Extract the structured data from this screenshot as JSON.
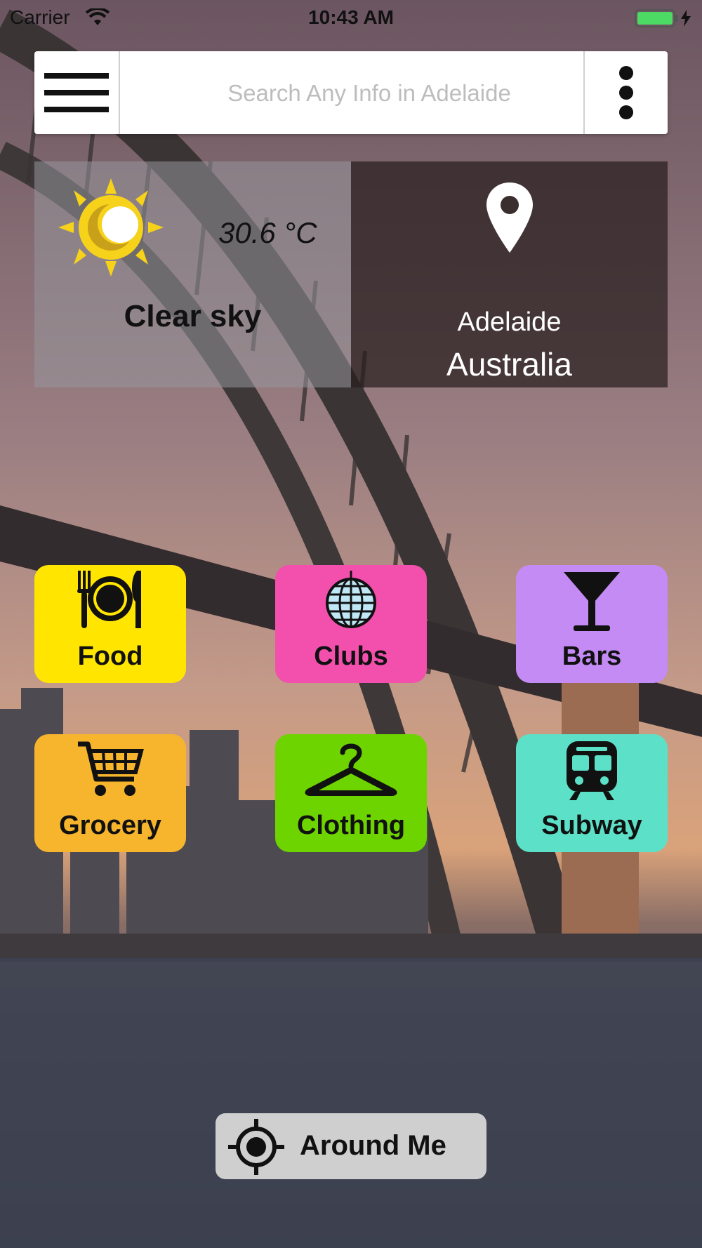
{
  "status_bar": {
    "carrier": "Carrier",
    "time": "10:43 AM"
  },
  "search": {
    "placeholder": "Search Any Info in Adelaide"
  },
  "weather": {
    "icon": "sun-moon-icon",
    "temperature": "30.6 °C",
    "description": "Clear sky"
  },
  "location": {
    "icon": "map-pin-icon",
    "city": "Adelaide",
    "country": "Australia"
  },
  "categories": [
    {
      "label": "Food",
      "icon": "food-plate-icon",
      "color": "#FFE500"
    },
    {
      "label": "Clubs",
      "icon": "disco-ball-icon",
      "color": "#F350AE"
    },
    {
      "label": "Bars",
      "icon": "cocktail-glass-icon",
      "color": "#C48BF5"
    },
    {
      "label": "Grocery",
      "icon": "shopping-cart-icon",
      "color": "#F7B52E"
    },
    {
      "label": "Clothing",
      "icon": "hanger-icon",
      "color": "#6DD400"
    },
    {
      "label": "Subway",
      "icon": "train-icon",
      "color": "#5CE1C8"
    }
  ],
  "around_me": {
    "label": "Around Me",
    "icon": "crosshair-icon"
  }
}
